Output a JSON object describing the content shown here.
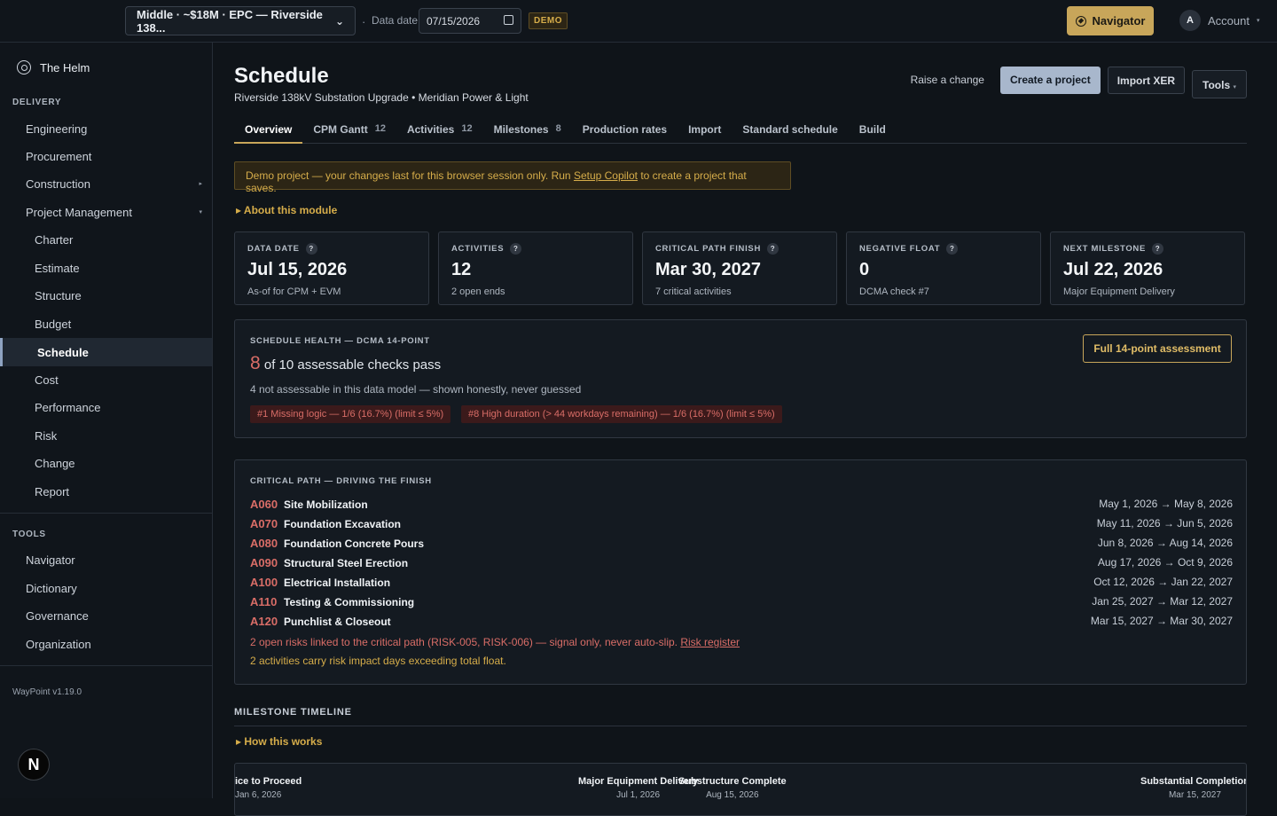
{
  "topbar": {
    "project": "Middle · ~$18M · EPC — Riverside 138...",
    "date_label": "Data date",
    "date_value": "07/15/2026",
    "demo": "DEMO",
    "navigator": "Navigator",
    "account_initial": "A",
    "account": "Account"
  },
  "sidebar": {
    "brand": "The Helm",
    "delivery": "DELIVERY",
    "items": [
      "Engineering",
      "Procurement",
      "Construction",
      "Project Management"
    ],
    "subitems": [
      "Charter",
      "Estimate",
      "Structure",
      "Budget",
      "Schedule",
      "Cost",
      "Performance",
      "Risk",
      "Change",
      "Report"
    ],
    "tools": "TOOLS",
    "tool_items": [
      "Navigator",
      "Dictionary",
      "Governance",
      "Organization"
    ],
    "version": "WayPoint v1.19.0",
    "badge": "N"
  },
  "page": {
    "title": "Schedule",
    "subtitle": "Riverside 138kV Substation Upgrade • Meridian Power & Light"
  },
  "actions": {
    "raise": "Raise a change",
    "create": "Create a project",
    "import": "Import XER",
    "tools": "Tools"
  },
  "tabs": [
    {
      "label": "Overview",
      "count": ""
    },
    {
      "label": "CPM Gantt",
      "count": "12"
    },
    {
      "label": "Activities",
      "count": "12"
    },
    {
      "label": "Milestones",
      "count": "8"
    },
    {
      "label": "Production rates",
      "count": ""
    },
    {
      "label": "Import",
      "count": ""
    },
    {
      "label": "Standard schedule",
      "count": ""
    },
    {
      "label": "Build",
      "count": ""
    }
  ],
  "banner": {
    "before": "Demo project — your changes last for this browser session only. Run ",
    "link": "Setup Copilot",
    "after": " to create a project that saves."
  },
  "about": "About this module",
  "kpis": [
    {
      "label": "DATA DATE",
      "value": "Jul 15, 2026",
      "sub": "As-of for CPM + EVM"
    },
    {
      "label": "ACTIVITIES",
      "value": "12",
      "sub": "2 open ends"
    },
    {
      "label": "CRITICAL PATH FINISH",
      "value": "Mar 30, 2027",
      "sub": "7 critical activities"
    },
    {
      "label": "NEGATIVE FLOAT",
      "value": "0",
      "sub": "DCMA check #7"
    },
    {
      "label": "NEXT MILESTONE",
      "value": "Jul 22, 2026",
      "sub": "Major Equipment Delivery"
    }
  ],
  "health": {
    "title": "SCHEDULE HEALTH — DCMA 14-POINT",
    "passed": "8",
    "pass_text": " of 10 assessable checks pass",
    "note": "4 not assessable in this data model — shown honestly, never guessed",
    "failures": [
      "#1 Missing logic — 1/6 (16.7%) (limit ≤ 5%)",
      "#8 High duration (> 44 workdays remaining) — 1/6 (16.7%) (limit ≤ 5%)"
    ],
    "button": "Full 14-point assessment"
  },
  "critical": {
    "title": "CRITICAL PATH — DRIVING THE FINISH",
    "rows": [
      {
        "code": "A060",
        "name": "Site Mobilization",
        "dates": "May 1, 2026 → May 8, 2026"
      },
      {
        "code": "A070",
        "name": "Foundation Excavation",
        "dates": "May 11, 2026 → Jun 5, 2026"
      },
      {
        "code": "A080",
        "name": "Foundation Concrete Pours",
        "dates": "Jun 8, 2026 → Aug 14, 2026"
      },
      {
        "code": "A090",
        "name": "Structural Steel Erection",
        "dates": "Aug 17, 2026 → Oct 9, 2026"
      },
      {
        "code": "A100",
        "name": "Electrical Installation",
        "dates": "Oct 12, 2026 → Jan 22, 2027"
      },
      {
        "code": "A110",
        "name": "Testing & Commissioning",
        "dates": "Jan 25, 2027 → Mar 12, 2027"
      },
      {
        "code": "A120",
        "name": "Punchlist & Closeout",
        "dates": "Mar 15, 2027 → Mar 30, 2027"
      }
    ],
    "risk_text": "2 open risks linked to the critical path (RISK-005, RISK-006) — signal only, never auto-slip. ",
    "risk_link": "Risk register",
    "float_text": "2 activities carry risk impact days exceeding total float."
  },
  "timeline": {
    "title": "MILESTONE TIMELINE",
    "how": "How this works",
    "milestones": [
      {
        "name": "ice to Proceed",
        "date": "Jan 6, 2026"
      },
      {
        "name": "Major Equipment Delivery",
        "date": "Jul 1, 2026"
      },
      {
        "name": "Substructure Complete",
        "date": "Aug 15, 2026"
      },
      {
        "name": "Substantial Completion",
        "date": "Mar 15, 2027"
      }
    ]
  }
}
